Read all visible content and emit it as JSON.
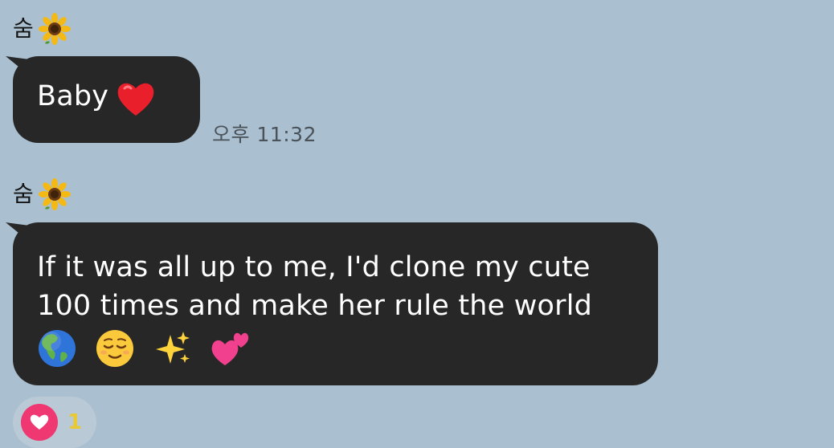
{
  "messages": [
    {
      "sender": "숨",
      "sender_icon": "sunflower-icon",
      "text": "Baby",
      "emoji": [
        "red-heart-emoji"
      ],
      "time": "오후 11:32"
    },
    {
      "sender": "숨",
      "sender_icon": "sunflower-icon",
      "text_line1": "If it was all up to me, I'd clone my cute",
      "text_line2": "100 times and make her rule the world",
      "emoji": [
        "globe-americas-emoji",
        "relieved-face-emoji",
        "sparkles-emoji",
        "two-hearts-emoji"
      ]
    }
  ],
  "reaction": {
    "icon": "heart-icon",
    "count": "1"
  },
  "colors": {
    "background": "#aabfcf",
    "bubble": "#272727",
    "reaction_heart": "#ef3772",
    "reaction_count": "#e8c934"
  }
}
